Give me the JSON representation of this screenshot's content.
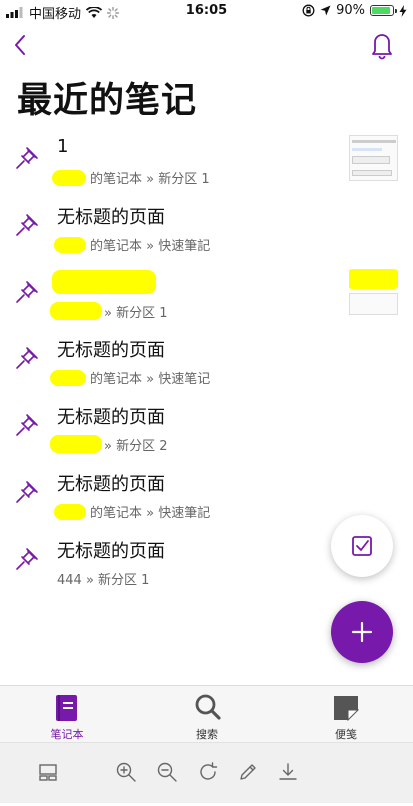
{
  "status": {
    "carrier": "中国移动",
    "time": "16:05",
    "battery": "90%",
    "battery_level": 0.9,
    "icons": [
      "signal-icon",
      "wifi-icon",
      "loading-icon",
      "orientation-lock-icon",
      "location-icon",
      "charging-icon"
    ]
  },
  "header": {
    "title": "最近的笔记",
    "back_icon": "chevron-left-icon",
    "bell_icon": "bell-icon"
  },
  "notes": [
    {
      "title": "1",
      "notebook": "的笔记本",
      "section": "新分区 1"
    },
    {
      "title": "无标题的页面",
      "notebook": "的笔记本",
      "section": "快速筆記"
    },
    {
      "title": "",
      "notebook": "",
      "section": "新分区 1"
    },
    {
      "title": "无标题的页面",
      "notebook": "的笔记本",
      "section": "快速笔记"
    },
    {
      "title": "无标题的页面",
      "notebook": "",
      "section": "新分区 2"
    },
    {
      "title": "无标题的页面",
      "notebook": "的笔记本",
      "section": "快速筆記"
    },
    {
      "title": "无标题的页面",
      "notebook": "444",
      "section": "新分区 1"
    }
  ],
  "tabs": [
    {
      "label": "笔记本",
      "icon": "notebook-icon",
      "active": true
    },
    {
      "label": "搜索",
      "icon": "search-icon",
      "active": false
    },
    {
      "label": "便笺",
      "icon": "sticky-note-icon",
      "active": false
    }
  ],
  "toolbar": [
    "layout-icon",
    "zoom-in-icon",
    "zoom-out-icon",
    "refresh-icon",
    "edit-icon",
    "download-icon"
  ],
  "colors": {
    "accent": "#7719aa",
    "redaction": "#ffff00",
    "battery": "#4cd964"
  }
}
